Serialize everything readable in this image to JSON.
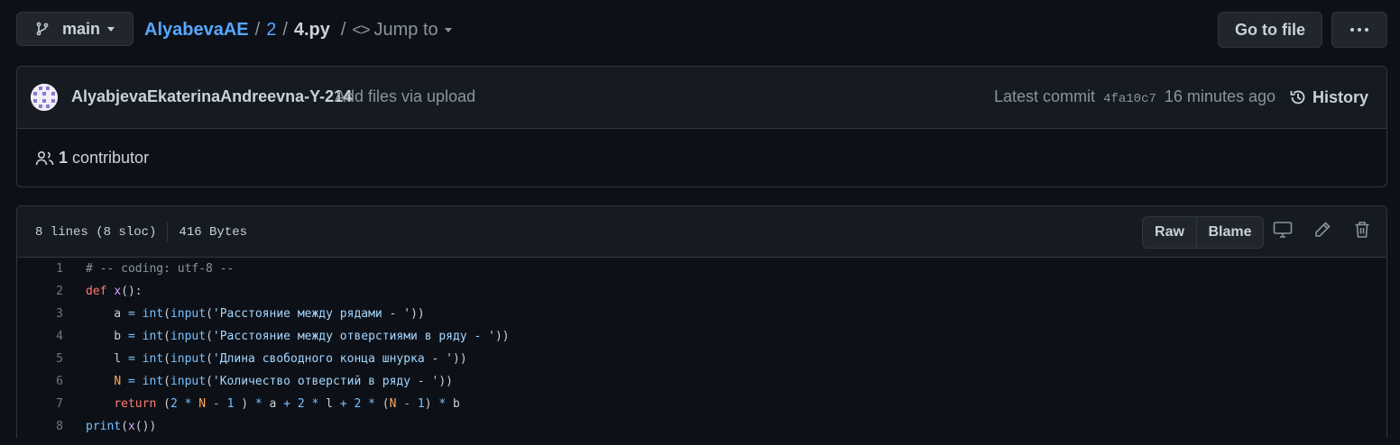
{
  "branch": {
    "label": "main",
    "icon": "git-branch-icon"
  },
  "breadcrumb": {
    "repo": "AlyabevaAE",
    "sep": "/",
    "folder": "2",
    "file": "4.py",
    "jump_to": "Jump to"
  },
  "top_actions": {
    "go_to_file": "Go to file",
    "more_icon": "kebab-horizontal-icon"
  },
  "commit": {
    "author": "AlyabjevaEkaterinaAndreevna-Y-214",
    "message": "Add files via upload",
    "latest_label": "Latest commit",
    "sha": "4fa10c7",
    "time": "16 minutes ago",
    "history": "History"
  },
  "contributors": {
    "count": "1",
    "label": "contributor"
  },
  "file": {
    "lines_info": "8 lines (8 sloc)",
    "size": "416 Bytes",
    "raw": "Raw",
    "blame": "Blame",
    "icons": [
      "desktop-icon",
      "pencil-icon",
      "trash-icon"
    ]
  },
  "code_lines": [
    {
      "n": "1",
      "tokens": [
        [
          "t-com",
          "# -- coding: utf-8 --"
        ]
      ]
    },
    {
      "n": "2",
      "tokens": [
        [
          "t-kw",
          "def"
        ],
        [
          "t-pl",
          " "
        ],
        [
          "t-fn",
          "x"
        ],
        [
          "t-pl",
          "():"
        ]
      ]
    },
    {
      "n": "3",
      "tokens": [
        [
          "t-pl",
          "    a "
        ],
        [
          "t-op",
          "="
        ],
        [
          "t-pl",
          " "
        ],
        [
          "t-bi",
          "int"
        ],
        [
          "t-pl",
          "("
        ],
        [
          "t-bi",
          "input"
        ],
        [
          "t-pl",
          "("
        ],
        [
          "t-str",
          "'Расстояние между рядами - '"
        ],
        [
          "t-pl",
          "))"
        ]
      ]
    },
    {
      "n": "4",
      "tokens": [
        [
          "t-pl",
          "    b "
        ],
        [
          "t-op",
          "="
        ],
        [
          "t-pl",
          " "
        ],
        [
          "t-bi",
          "int"
        ],
        [
          "t-pl",
          "("
        ],
        [
          "t-bi",
          "input"
        ],
        [
          "t-pl",
          "("
        ],
        [
          "t-str",
          "'Расстояние между отверстиями в ряду - '"
        ],
        [
          "t-pl",
          "))"
        ]
      ]
    },
    {
      "n": "5",
      "tokens": [
        [
          "t-pl",
          "    l "
        ],
        [
          "t-op",
          "="
        ],
        [
          "t-pl",
          " "
        ],
        [
          "t-bi",
          "int"
        ],
        [
          "t-pl",
          "("
        ],
        [
          "t-bi",
          "input"
        ],
        [
          "t-pl",
          "("
        ],
        [
          "t-str",
          "'Длина свободного конца шнурка - '"
        ],
        [
          "t-pl",
          "))"
        ]
      ]
    },
    {
      "n": "6",
      "tokens": [
        [
          "t-pl",
          "    "
        ],
        [
          "t-var",
          "N"
        ],
        [
          "t-pl",
          " "
        ],
        [
          "t-op",
          "="
        ],
        [
          "t-pl",
          " "
        ],
        [
          "t-bi",
          "int"
        ],
        [
          "t-pl",
          "("
        ],
        [
          "t-bi",
          "input"
        ],
        [
          "t-pl",
          "("
        ],
        [
          "t-str",
          "'Количество отверстий в ряду - '"
        ],
        [
          "t-pl",
          "))"
        ]
      ]
    },
    {
      "n": "7",
      "tokens": [
        [
          "t-pl",
          "    "
        ],
        [
          "t-kw",
          "return"
        ],
        [
          "t-pl",
          " ("
        ],
        [
          "t-num",
          "2"
        ],
        [
          "t-pl",
          " "
        ],
        [
          "t-op",
          "*"
        ],
        [
          "t-pl",
          " "
        ],
        [
          "t-var",
          "N"
        ],
        [
          "t-pl",
          " "
        ],
        [
          "t-op",
          "-"
        ],
        [
          "t-pl",
          " "
        ],
        [
          "t-num",
          "1"
        ],
        [
          "t-pl",
          " ) "
        ],
        [
          "t-op",
          "*"
        ],
        [
          "t-pl",
          " a "
        ],
        [
          "t-op",
          "+"
        ],
        [
          "t-pl",
          " "
        ],
        [
          "t-num",
          "2"
        ],
        [
          "t-pl",
          " "
        ],
        [
          "t-op",
          "*"
        ],
        [
          "t-pl",
          " l "
        ],
        [
          "t-op",
          "+"
        ],
        [
          "t-pl",
          " "
        ],
        [
          "t-num",
          "2"
        ],
        [
          "t-pl",
          " "
        ],
        [
          "t-op",
          "*"
        ],
        [
          "t-pl",
          " ("
        ],
        [
          "t-var",
          "N"
        ],
        [
          "t-pl",
          " "
        ],
        [
          "t-op",
          "-"
        ],
        [
          "t-pl",
          " "
        ],
        [
          "t-num",
          "1"
        ],
        [
          "t-pl",
          ") "
        ],
        [
          "t-op",
          "*"
        ],
        [
          "t-pl",
          " b"
        ]
      ]
    },
    {
      "n": "8",
      "tokens": [
        [
          "t-bi",
          "print"
        ],
        [
          "t-pl",
          "("
        ],
        [
          "t-fn",
          "x"
        ],
        [
          "t-pl",
          "())"
        ]
      ]
    }
  ]
}
